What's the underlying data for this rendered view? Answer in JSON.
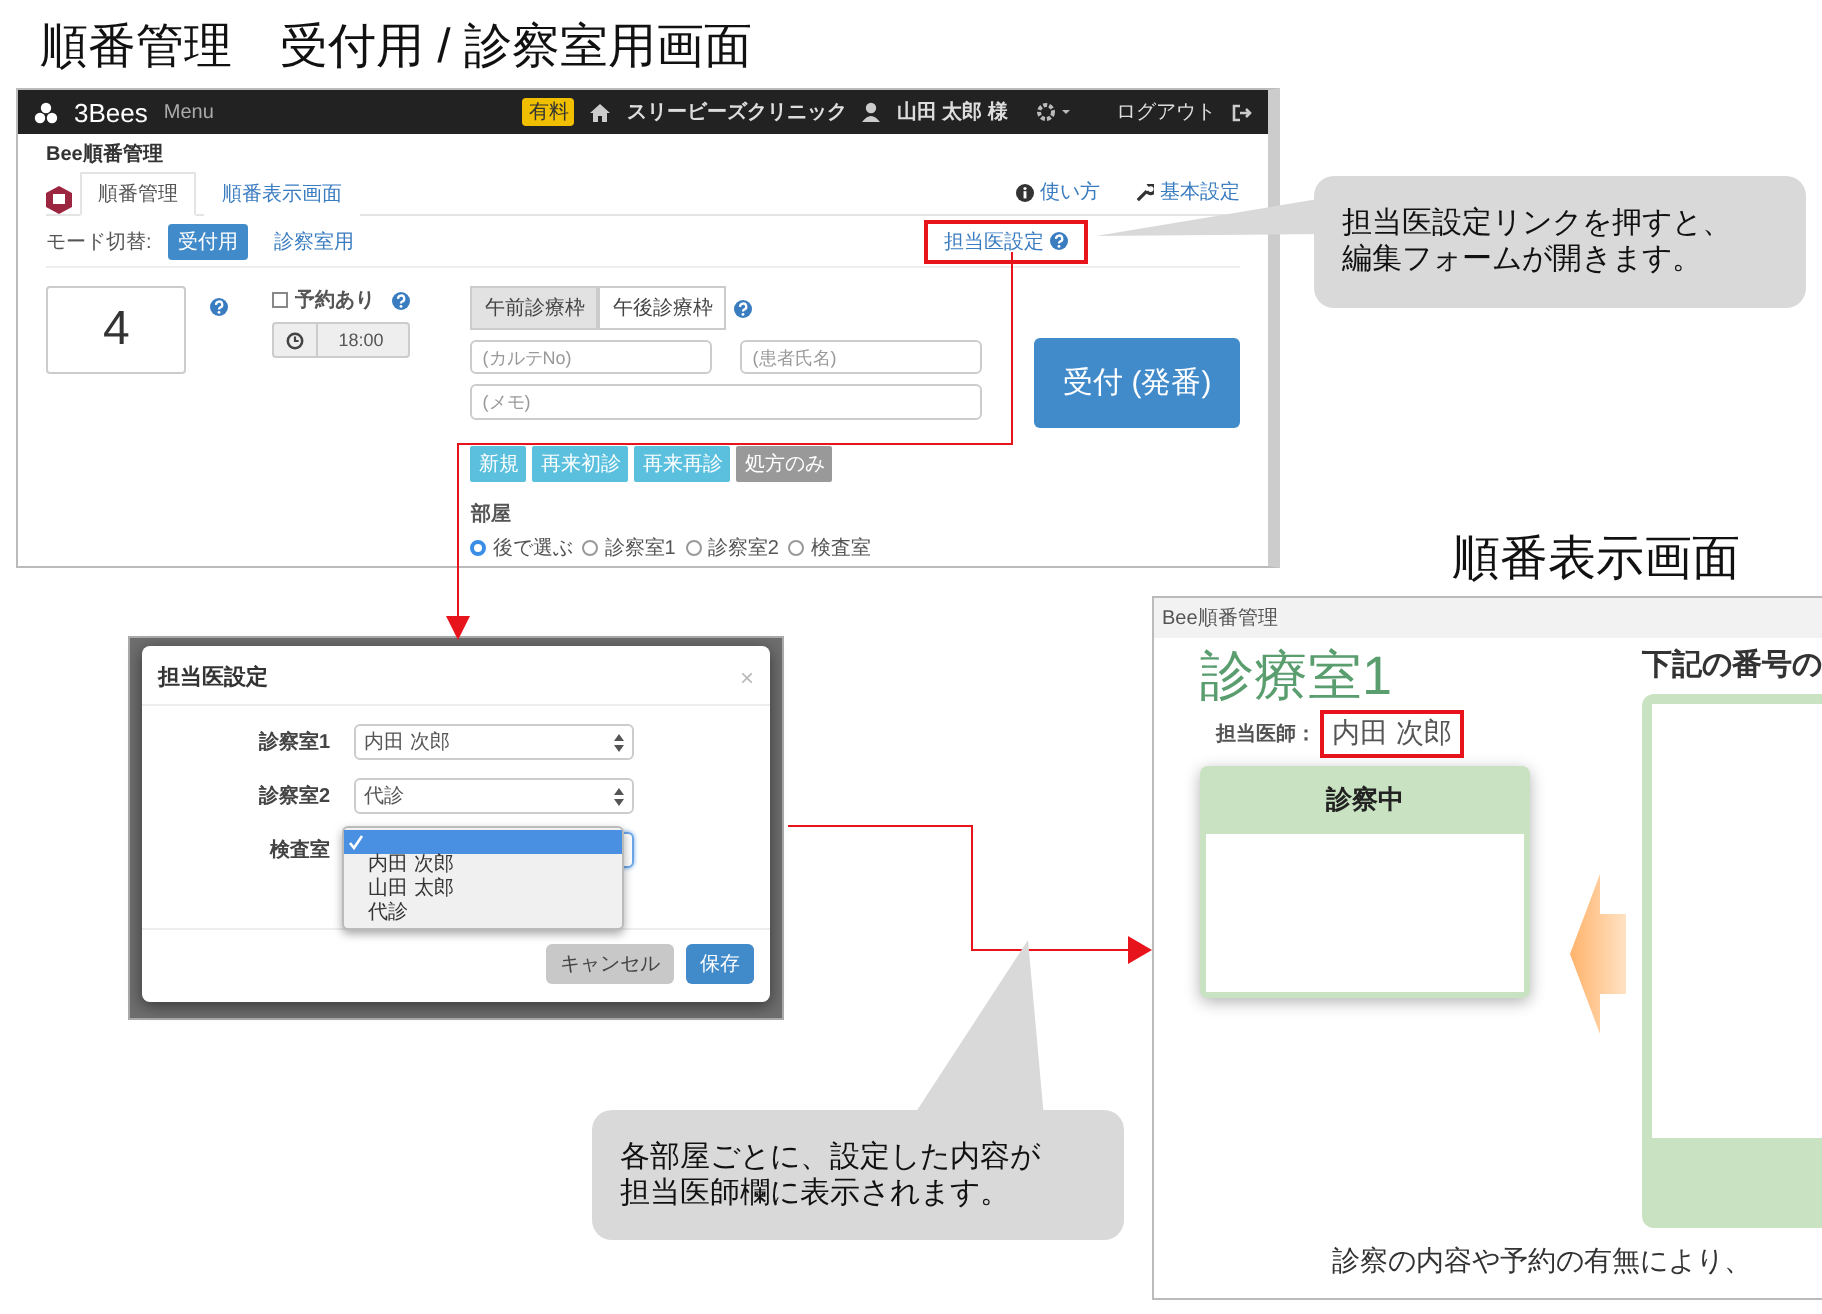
{
  "headings": [
    "順番管理　受付用 / 診察室用画面",
    "順番表示画面"
  ],
  "reception": {
    "navbar": {
      "brand": "3Bees",
      "menu": "Menu",
      "badge": "有料",
      "clinic": "スリービーズクリニック",
      "user": "山田 太郎 様",
      "logout": "ログアウト"
    },
    "app_title": "Bee順番管理",
    "tabs": [
      {
        "label": "順番管理",
        "selected": true
      },
      {
        "label": "順番表示画面",
        "selected": false
      }
    ],
    "links": [
      {
        "label": "使い方",
        "kind": "info"
      },
      {
        "label": "基本設定",
        "kind": "wrench"
      }
    ],
    "mode_label": "モード切替:",
    "modes": [
      {
        "label": "受付用",
        "selected": true
      },
      {
        "label": "診察室用",
        "selected": false
      }
    ],
    "doctor_link": "担当医設定",
    "number": "4",
    "reservation": {
      "label": "予約あり",
      "checked": false,
      "time": "18:00"
    },
    "slots": [
      {
        "label": "午前診療枠",
        "selected": true
      },
      {
        "label": "午後診療枠",
        "selected": false
      }
    ],
    "fields": [
      {
        "placeholder": "(カルテNo)"
      },
      {
        "placeholder": "(患者氏名)"
      },
      {
        "placeholder": "(メモ)"
      }
    ],
    "submit": "受付 (発番)",
    "types": [
      {
        "label": "新規",
        "kind": "info"
      },
      {
        "label": "再来初診",
        "kind": "info"
      },
      {
        "label": "再来再診",
        "kind": "info"
      },
      {
        "label": "処方のみ",
        "kind": "muted"
      }
    ],
    "room_label": "部屋",
    "rooms": [
      {
        "label": "後で選ぶ",
        "selected": true
      },
      {
        "label": "診察室1",
        "selected": false
      },
      {
        "label": "診察室2",
        "selected": false
      },
      {
        "label": "検査室",
        "selected": false
      }
    ]
  },
  "dialog": {
    "title": "担当医設定",
    "close": "×",
    "rows": [
      {
        "label": "診察室1",
        "value": "内田 次郎",
        "open": false
      },
      {
        "label": "診察室2",
        "value": "代診",
        "open": false
      },
      {
        "label": "検査室",
        "open": true,
        "options": [
          {
            "selected": true
          },
          {
            "label": "内田 次郎",
            "selected": false
          },
          {
            "label": "山田 太郎",
            "selected": false
          },
          {
            "label": "代診",
            "selected": false
          }
        ]
      }
    ],
    "buttons": [
      {
        "label": "キャンセル",
        "kind": "default"
      },
      {
        "label": "保存",
        "kind": "primary"
      }
    ]
  },
  "display": {
    "window_title": "Bee順番管理",
    "room": "診療室1",
    "doctor_label": "担当医師：",
    "doctor": "内田 次郎",
    "current_label": "診察中",
    "queue_heading": "下記の番号の",
    "footer": "診察の内容や予約の有無により、"
  },
  "callouts": [
    [
      "担当医設定リンクを押すと、",
      "編集フォームが開きます。"
    ],
    [
      "各部屋ごとに、設定した内容が",
      "担当医師欄に表示されます。"
    ]
  ]
}
